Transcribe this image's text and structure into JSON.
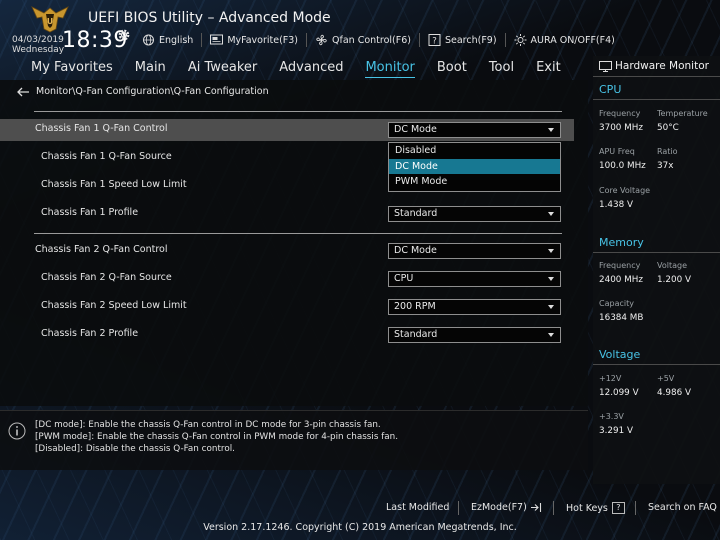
{
  "header": {
    "title": "UEFI BIOS Utility – Advanced Mode",
    "date": "04/03/2019",
    "weekday": "Wednesday",
    "time": "18:39",
    "toolbar": [
      {
        "label": "English",
        "icon": "globe-icon"
      },
      {
        "label": "MyFavorite(F3)",
        "icon": "favorite-icon"
      },
      {
        "label": "Qfan Control(F6)",
        "icon": "fan-icon"
      },
      {
        "label": "Search(F9)",
        "icon": "search-icon"
      },
      {
        "label": "AURA ON/OFF(F4)",
        "icon": "aura-icon"
      }
    ]
  },
  "nav": {
    "items": [
      "My Favorites",
      "Main",
      "Ai Tweaker",
      "Advanced",
      "Monitor",
      "Boot",
      "Tool",
      "Exit"
    ],
    "active": "Monitor"
  },
  "breadcrumb": "Monitor\\Q-Fan Configuration\\Q-Fan Configuration",
  "settings": [
    {
      "label": "Chassis Fan 1 Q-Fan Control",
      "value": "DC Mode"
    },
    {
      "label": "Chassis Fan 1 Q-Fan Source",
      "value": ""
    },
    {
      "label": "Chassis Fan 1 Speed Low Limit",
      "value": ""
    },
    {
      "label": "Chassis Fan 1 Profile",
      "value": "Standard"
    },
    {
      "label": "Chassis Fan 2 Q-Fan Control",
      "value": "DC Mode"
    },
    {
      "label": "Chassis Fan 2 Q-Fan Source",
      "value": "CPU"
    },
    {
      "label": "Chassis Fan 2 Speed Low Limit",
      "value": "200 RPM"
    },
    {
      "label": "Chassis Fan 2 Profile",
      "value": "Standard"
    }
  ],
  "dropdown": {
    "options": [
      "Disabled",
      "DC Mode",
      "PWM Mode"
    ],
    "selected": "DC Mode"
  },
  "help": [
    "[DC mode]: Enable the chassis Q-Fan control in DC mode for 3-pin chassis fan.",
    "[PWM mode]: Enable the chassis Q-Fan control in PWM mode for 4-pin chassis fan.",
    "[Disabled]: Disable the chassis Q-Fan control."
  ],
  "hardware_monitor": {
    "title": "Hardware Monitor",
    "cpu": {
      "heading": "CPU",
      "frequency_label": "Frequency",
      "frequency": "3700 MHz",
      "temperature_label": "Temperature",
      "temperature": "50°C",
      "apu_freq_label": "APU Freq",
      "apu_freq": "100.0 MHz",
      "ratio_label": "Ratio",
      "ratio": "37x",
      "core_voltage_label": "Core Voltage",
      "core_voltage": "1.438 V"
    },
    "memory": {
      "heading": "Memory",
      "frequency_label": "Frequency",
      "frequency": "2400 MHz",
      "voltage_label": "Voltage",
      "voltage": "1.200 V",
      "capacity_label": "Capacity",
      "capacity": "16384 MB"
    },
    "voltage": {
      "heading": "Voltage",
      "v12_label": "+12V",
      "v12": "12.099 V",
      "v5_label": "+5V",
      "v5": "4.986 V",
      "v33_label": "+3.3V",
      "v33": "3.291 V"
    }
  },
  "footer": {
    "last_modified": "Last Modified",
    "ezmode": "EzMode(F7)",
    "hot_keys": "Hot Keys",
    "hot_keys_key": "?",
    "search_faq": "Search on FAQ",
    "version": "Version 2.17.1246. Copyright (C) 2019 American Megatrends, Inc."
  },
  "colors": {
    "accent": "#48c3e6",
    "selected_option": "#177892",
    "highlight_row": "#4e4e4e",
    "logo": "#c8962e"
  }
}
